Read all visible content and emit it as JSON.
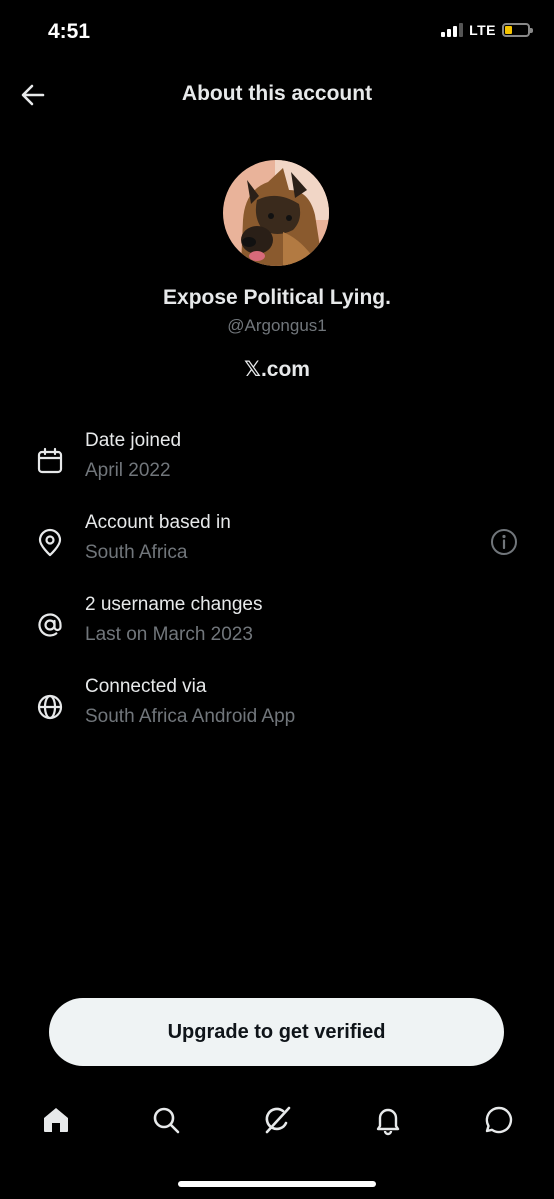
{
  "status_bar": {
    "time": "4:51",
    "network": "LTE",
    "battery_level": 0.3
  },
  "header": {
    "title": "About this account",
    "back_icon": "arrow-left-icon"
  },
  "profile": {
    "display_name": "Expose Political Lying.",
    "handle": "@Argongus1",
    "site": "𝕏.com",
    "avatar": "german-shepherd-photo"
  },
  "info": [
    {
      "icon": "calendar-icon",
      "label": "Date joined",
      "value": "April 2022"
    },
    {
      "icon": "location-pin-icon",
      "label": "Account based in",
      "value": "South Africa",
      "has_info_button": true
    },
    {
      "icon": "at-sign-icon",
      "label": "2 username changes",
      "value": "Last on March 2023"
    },
    {
      "icon": "globe-icon",
      "label": "Connected via",
      "value": "South Africa Android App"
    }
  ],
  "cta": {
    "label": "Upgrade to get verified"
  },
  "tabs": [
    {
      "name": "home",
      "icon": "home-icon",
      "active": true
    },
    {
      "name": "search",
      "icon": "search-icon"
    },
    {
      "name": "grok",
      "icon": "grok-icon"
    },
    {
      "name": "notifications",
      "icon": "bell-icon"
    },
    {
      "name": "messages",
      "icon": "chat-bubble-icon"
    }
  ],
  "colors": {
    "background": "#000000",
    "primary_text": "#e7e9ea",
    "secondary_text": "#71767b",
    "button_bg": "#eff3f4",
    "battery": "#f5c400"
  }
}
